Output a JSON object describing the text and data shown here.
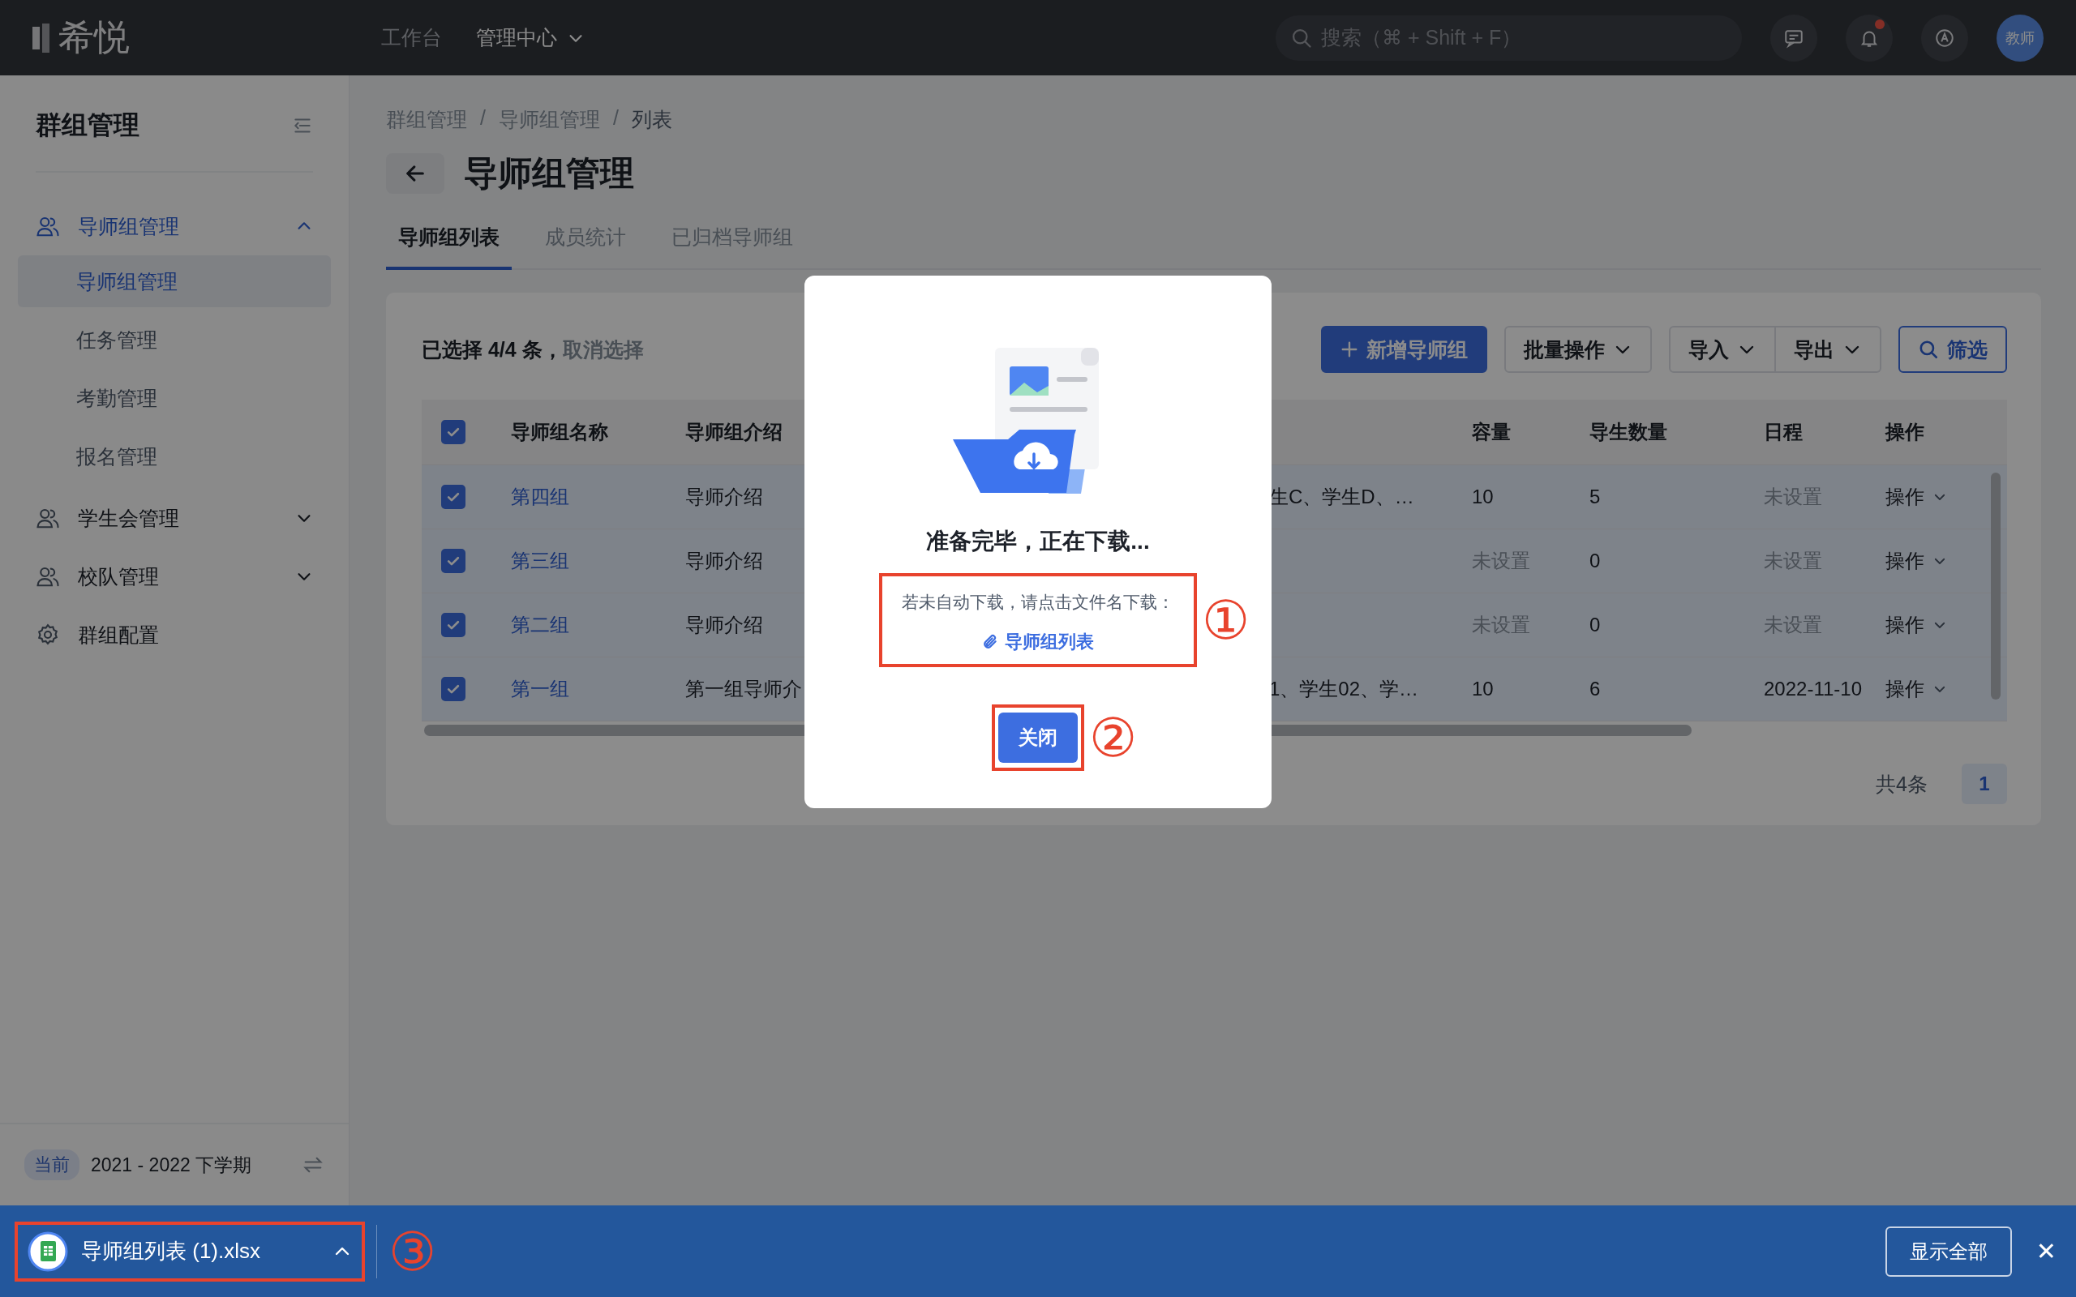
{
  "top_bar": {
    "logo": "希悦",
    "nav": [
      {
        "label": "工作台",
        "selected": false,
        "has_menu": false
      },
      {
        "label": "管理中心",
        "selected": true,
        "has_menu": true
      }
    ],
    "search": {
      "placeholder": "搜索（⌘ + Shift + F）"
    },
    "unread": true,
    "avatar": "教师"
  },
  "sidebar": {
    "title": "群组管理",
    "menu": [
      {
        "label": "导师组管理",
        "kind": "group",
        "expanded": true,
        "children": [
          {
            "label": "导师组管理",
            "selected": true
          },
          {
            "label": "任务管理",
            "selected": false
          },
          {
            "label": "考勤管理",
            "selected": false
          },
          {
            "label": "报名管理",
            "selected": false
          }
        ]
      },
      {
        "label": "学生会管理",
        "kind": "group",
        "expanded": false
      },
      {
        "label": "校队管理",
        "kind": "group",
        "expanded": false
      },
      {
        "label": "群组配置",
        "kind": "settings"
      }
    ],
    "term": {
      "badge": "当前",
      "label": "2021 - 2022 下学期"
    }
  },
  "breadcrumb": {
    "separator": "/",
    "items": [
      "群组管理",
      "导师组管理",
      "列表"
    ]
  },
  "page_title": "导师组管理",
  "tabs": [
    {
      "label": "导师组列表",
      "selected": true
    },
    {
      "label": "成员统计",
      "selected": false
    },
    {
      "label": "已归档导师组",
      "selected": false
    }
  ],
  "toolbar": {
    "selection": "已选择 4/4 条，",
    "clear_link": "取消选择",
    "buttons": [
      {
        "label": "新增导师组",
        "kind": "primary"
      },
      {
        "label": "批量操作",
        "kind": "menu"
      },
      {
        "label": "导入",
        "kind": "joined-menu"
      },
      {
        "label": "导出",
        "kind": "joined-menu"
      },
      {
        "label": "筛选",
        "kind": "filter"
      }
    ]
  },
  "table": {
    "all_checked": true,
    "headers": {
      "name": "导师组名称",
      "intro": "导师组介绍",
      "capacity": "容量",
      "count": "导生数量",
      "schedule": "日程",
      "action": "操作"
    },
    "rows": [
      {
        "checked": true,
        "name": "第四组",
        "intro": "导师介绍",
        "members": "生C、学生D、…",
        "capacity": "10",
        "capacity_set": true,
        "count": "5",
        "schedule": "未设置",
        "schedule_set": false,
        "action": "操作"
      },
      {
        "checked": true,
        "name": "第三组",
        "intro": "导师介绍",
        "capacity": "未设置",
        "capacity_set": false,
        "count": "0",
        "schedule": "未设置",
        "schedule_set": false,
        "action": "操作"
      },
      {
        "checked": true,
        "name": "第二组",
        "intro": "导师介绍",
        "capacity": "未设置",
        "capacity_set": false,
        "count": "0",
        "schedule": "未设置",
        "schedule_set": false,
        "action": "操作"
      },
      {
        "checked": true,
        "name": "第一组",
        "intro": "第一组导师介",
        "members": "1、学生02、学…",
        "capacity": "10",
        "capacity_set": true,
        "count": "6",
        "schedule": "2022-11-10",
        "schedule_set": true,
        "action": "操作"
      }
    ]
  },
  "pagination": {
    "total": "共4条",
    "pages": [
      {
        "label": "1",
        "selected": true
      }
    ]
  },
  "dialog": {
    "title": "准备完毕，正在下载...",
    "hint": "若未自动下载，请点击文件名下载：",
    "file_link": "导师组列表",
    "hint_marker": "①",
    "close_button": "关闭",
    "button_marker": "②"
  },
  "download_bar": {
    "file": "导师组列表 (1).xlsx",
    "marker": "③",
    "show_all": "显示全部",
    "close": "✕"
  }
}
